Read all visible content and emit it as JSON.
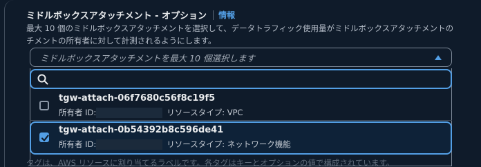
{
  "field": {
    "label": "ミドルボックスアタッチメント - オプション",
    "info_link": "情報",
    "description_line1": "最大 10 個のミドルボックスアタッチメントを選択して、データトラフィック使用量がミドルボックスアタッチメントの",
    "description_line2": "チメントの所有者に対して計測されるようにします。"
  },
  "select": {
    "placeholder": "ミドルボックスアタッチメントを最大 10 個選択します",
    "caret_icon": "caret-up-icon"
  },
  "search": {
    "value": "",
    "icon": "search-icon"
  },
  "options": [
    {
      "title": "tgw-attach-06f7680c56f8c19f5",
      "owner_label": "所有者 ID:",
      "resource_type": "リソースタイプ: VPC",
      "checked": false
    },
    {
      "title": "tgw-attach-0b54392b8c596de41",
      "owner_label": "所有者 ID:",
      "resource_type": "リソースタイプ: ネットワーク機能",
      "checked": true
    }
  ],
  "bottom_text": "タグは、AWS リソースに割り当てるラベルです。各タグはキーとオプションの値で構成されています。",
  "colors": {
    "accent": "#539fe5",
    "background": "#0f1b2a",
    "selected_bg": "#0e2238"
  }
}
